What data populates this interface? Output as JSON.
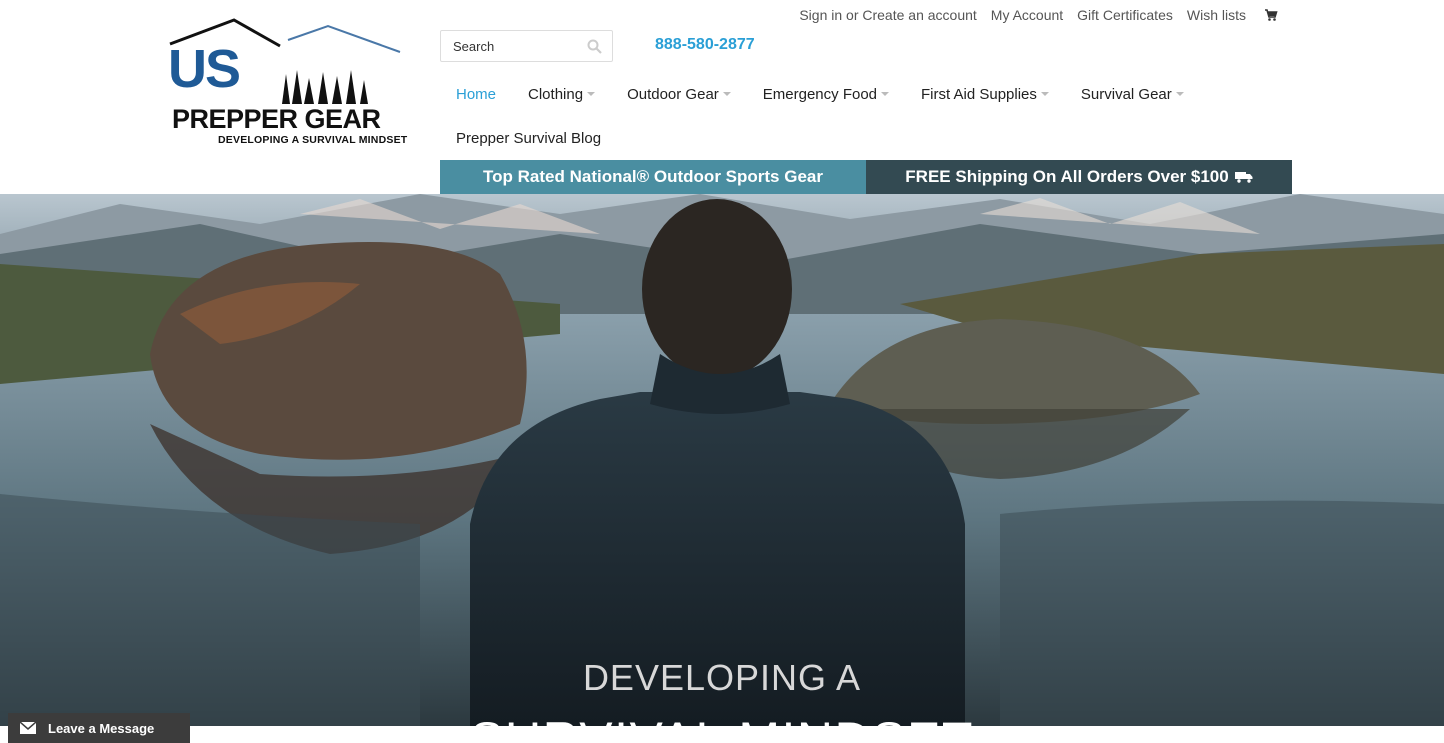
{
  "logo": {
    "mark_text": "US",
    "name": "PREPPER GEAR",
    "tagline": "DEVELOPING A SURVIVAL MINDSET",
    "brand_color": "#1f5a96"
  },
  "top_links": {
    "sign_in": "Sign in or Create an account",
    "my_account": "My Account",
    "gift_certificates": "Gift Certificates",
    "wish_lists": "Wish lists",
    "cart_icon": "cart-icon"
  },
  "search": {
    "placeholder": "Search",
    "icon": "search-icon"
  },
  "phone": "888-580-2877",
  "nav": {
    "row1": [
      {
        "label": "Home",
        "active": true
      },
      {
        "label": "Clothing",
        "dropdown": true
      },
      {
        "label": "Outdoor Gear",
        "dropdown": true
      },
      {
        "label": "Emergency Food",
        "dropdown": true
      },
      {
        "label": "First Aid Supplies",
        "dropdown": true
      },
      {
        "label": "Survival Gear",
        "dropdown": true
      }
    ],
    "row2": [
      {
        "label": "Prepper Survival Blog"
      }
    ]
  },
  "promos": {
    "left": "Top Rated National® Outdoor Sports Gear",
    "right": "FREE Shipping On All Orders Over $100",
    "left_color": "#4a8ea1",
    "right_color": "#334a52"
  },
  "hero": {
    "line1": "DEVELOPING A",
    "line2": "SURVIVAL MINDSET"
  },
  "chat": {
    "label": "Leave a Message",
    "icon": "envelope-icon"
  },
  "colors": {
    "accent": "#2a9fd6"
  }
}
